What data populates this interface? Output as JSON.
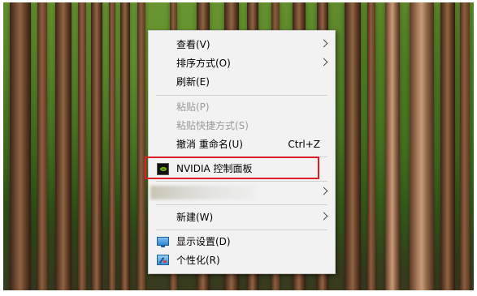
{
  "context_menu": {
    "items": [
      {
        "id": "view",
        "label": "查看(V)",
        "has_submenu": true,
        "disabled": false
      },
      {
        "id": "sort",
        "label": "排序方式(O)",
        "has_submenu": true,
        "disabled": false
      },
      {
        "id": "refresh",
        "label": "刷新(E)",
        "has_submenu": false,
        "disabled": false
      },
      {
        "id": "paste",
        "label": "粘贴(P)",
        "has_submenu": false,
        "disabled": true
      },
      {
        "id": "paste_shortcut",
        "label": "粘贴快捷方式(S)",
        "has_submenu": false,
        "disabled": true
      },
      {
        "id": "undo_rename",
        "label": "撤消 重命名(U)",
        "shortcut": "Ctrl+Z",
        "has_submenu": false,
        "disabled": false
      },
      {
        "id": "nvidia",
        "label": "NVIDIA 控制面板",
        "icon": "nvidia-icon",
        "highlighted": true
      },
      {
        "id": "blurred_item",
        "label": "",
        "has_submenu": true,
        "note_visible": "redacted/blurred entry"
      },
      {
        "id": "new",
        "label": "新建(W)",
        "has_submenu": true,
        "disabled": false
      },
      {
        "id": "display_settings",
        "label": "显示设置(D)",
        "icon": "display-icon"
      },
      {
        "id": "personalize",
        "label": "个性化(R)",
        "icon": "personalize-icon"
      }
    ]
  },
  "colors": {
    "menu_bg": "#f2f2f2",
    "highlight_border": "#e01e27",
    "disabled_text": "#9a9a9a"
  }
}
